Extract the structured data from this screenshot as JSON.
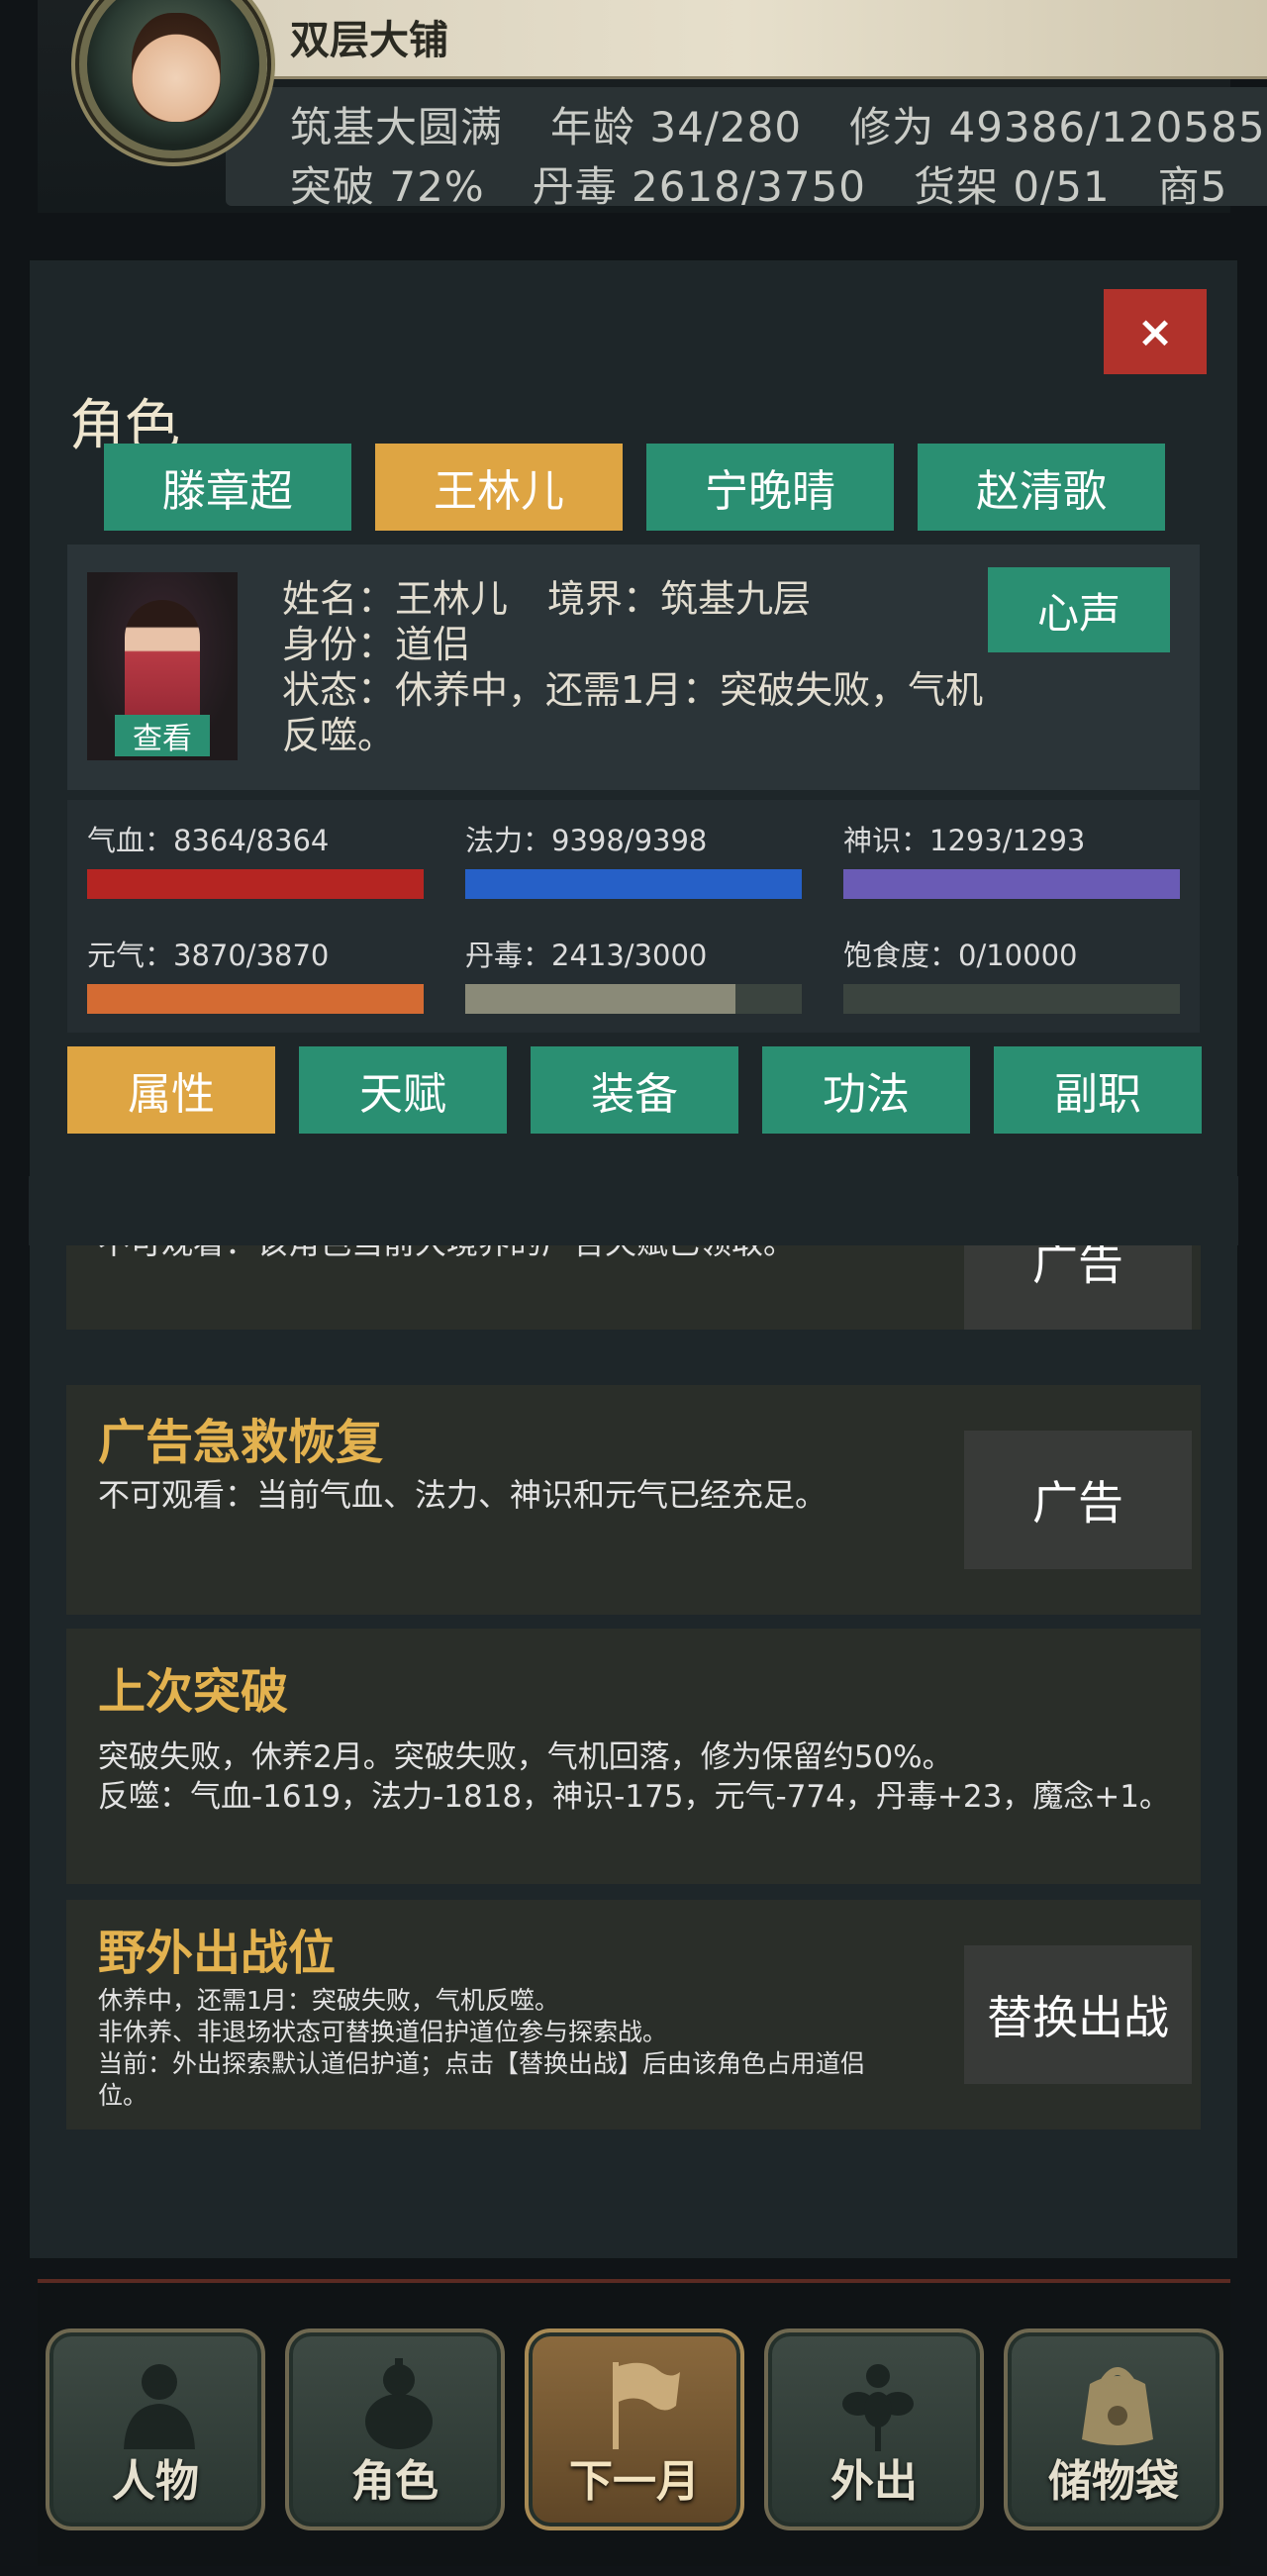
{
  "header": {
    "title_line": "双层大铺",
    "stats_line1": [
      "筑基大圆满",
      "年龄 34/280",
      "修为 49386/120585"
    ],
    "stats_line2": [
      "突破 72%",
      "丹毒 2618/3750",
      "货架 0/51",
      "商5"
    ]
  },
  "modal": {
    "close_label": "×",
    "section_title": "角色",
    "character_tabs": [
      {
        "label": "滕章超",
        "active": false
      },
      {
        "label": "王林儿",
        "active": true
      },
      {
        "label": "宁晚晴",
        "active": false
      },
      {
        "label": "赵清歌",
        "active": false
      }
    ],
    "character": {
      "name_line": "姓名：王林儿",
      "realm_line": "境界：筑基九层",
      "identity_line": "身份：道侣",
      "status_line": "状态：休养中，还需1月：突破失败，气机反噬。",
      "view_label": "查看",
      "voice_label": "心声"
    },
    "stats": [
      {
        "label": "气血：8364/8364",
        "fraction": 1.0,
        "color": "#b52522"
      },
      {
        "label": "法力：9398/9398",
        "fraction": 1.0,
        "color": "#2660c7"
      },
      {
        "label": "神识：1293/1293",
        "fraction": 1.0,
        "color": "#6a5bb5"
      },
      {
        "label": "元气：3870/3870",
        "fraction": 1.0,
        "color": "#d46b33"
      },
      {
        "label": "丹毒：2413/3000",
        "fraction": 0.804,
        "color": "#8a8a78"
      },
      {
        "label": "饱食度：0/10000",
        "fraction": 0.0,
        "color": "#6b7a5c"
      }
    ],
    "sub_tabs": [
      {
        "label": "属性",
        "active": true
      },
      {
        "label": "天赋",
        "active": false
      },
      {
        "label": "装备",
        "active": false
      },
      {
        "label": "功法",
        "active": false
      },
      {
        "label": "副职",
        "active": false
      }
    ],
    "cards": {
      "partial": {
        "text": "不可观看：该角色当前大境界的广告天赋已领取。",
        "button": "广告"
      },
      "emergency": {
        "title": "广告急救恢复",
        "text": "不可观看：当前气血、法力、神识和元气已经充足。",
        "button": "广告"
      },
      "last_breakthrough": {
        "title": "上次突破",
        "line1": "突破失败，休养2月。突破失败，气机回落，修为保留约50%。",
        "line2": "反噬：气血-1619，法力-1818，神识-175，元气-774，丹毒+23，魔念+1。"
      },
      "field_slot": {
        "title": "野外出战位",
        "line1": "休养中，还需1月：突破失败，气机反噬。",
        "line2": "非休养、非退场状态可替换道侣护道位参与探索战。",
        "line3": "当前：外出探索默认道侣护道；点击【替换出战】后由该角色占用道侣位。",
        "button": "替换出战"
      }
    }
  },
  "bottom_nav": [
    {
      "label": "人物",
      "icon": "person-icon",
      "active": false
    },
    {
      "label": "角色",
      "icon": "gourd-icon",
      "active": false
    },
    {
      "label": "下一月",
      "icon": "flag-icon",
      "active": true
    },
    {
      "label": "外出",
      "icon": "flower-icon",
      "active": false
    },
    {
      "label": "储物袋",
      "icon": "bag-icon",
      "active": false
    }
  ]
}
